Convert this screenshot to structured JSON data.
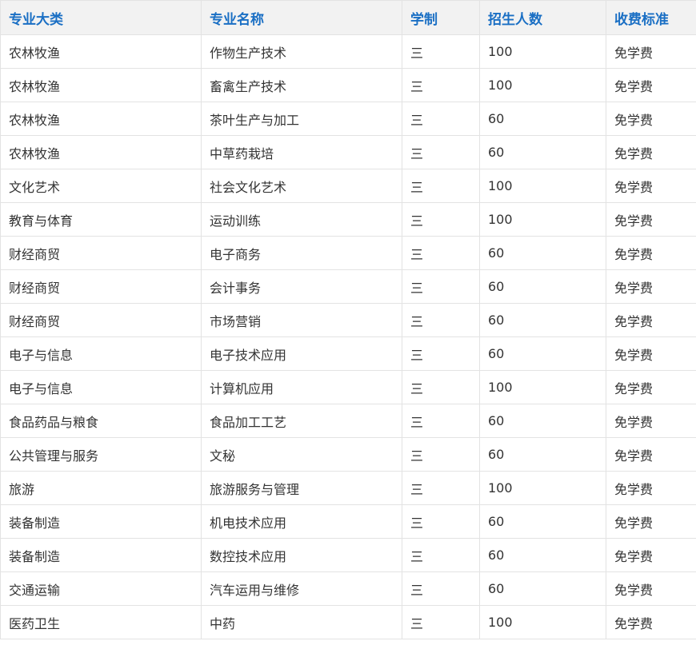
{
  "colors": {
    "header_text": "#1a6fc4",
    "header_bg": "#f2f2f2",
    "body_text": "#333333",
    "border": "#e3e3e3"
  },
  "table": {
    "headers": [
      "专业大类",
      "专业名称",
      "学制",
      "招生人数",
      "收费标准"
    ],
    "rows": [
      [
        "农林牧渔",
        "作物生产技术",
        "三",
        "100",
        "免学费"
      ],
      [
        "农林牧渔",
        "畜禽生产技术",
        "三",
        "100",
        "免学费"
      ],
      [
        "农林牧渔",
        "茶叶生产与加工",
        "三",
        "60",
        "免学费"
      ],
      [
        "农林牧渔",
        "中草药栽培",
        "三",
        "60",
        "免学费"
      ],
      [
        "文化艺术",
        "社会文化艺术",
        "三",
        "100",
        "免学费"
      ],
      [
        "教育与体育",
        "运动训练",
        "三",
        "100",
        "免学费"
      ],
      [
        "财经商贸",
        "电子商务",
        "三",
        "60",
        "免学费"
      ],
      [
        "财经商贸",
        "会计事务",
        "三",
        "60",
        "免学费"
      ],
      [
        "财经商贸",
        "市场营销",
        "三",
        "60",
        "免学费"
      ],
      [
        "电子与信息",
        "电子技术应用",
        "三",
        "60",
        "免学费"
      ],
      [
        "电子与信息",
        "计算机应用",
        "三",
        "100",
        "免学费"
      ],
      [
        "食品药品与粮食",
        "食品加工工艺",
        "三",
        "60",
        "免学费"
      ],
      [
        "公共管理与服务",
        "文秘",
        "三",
        "60",
        "免学费"
      ],
      [
        "旅游",
        "旅游服务与管理",
        "三",
        "100",
        "免学费"
      ],
      [
        "装备制造",
        "机电技术应用",
        "三",
        "60",
        "免学费"
      ],
      [
        "装备制造",
        "数控技术应用",
        "三",
        "60",
        "免学费"
      ],
      [
        "交通运输",
        "汽车运用与维修",
        "三",
        "60",
        "免学费"
      ],
      [
        "医药卫生",
        "中药",
        "三",
        "100",
        "免学费"
      ]
    ]
  }
}
